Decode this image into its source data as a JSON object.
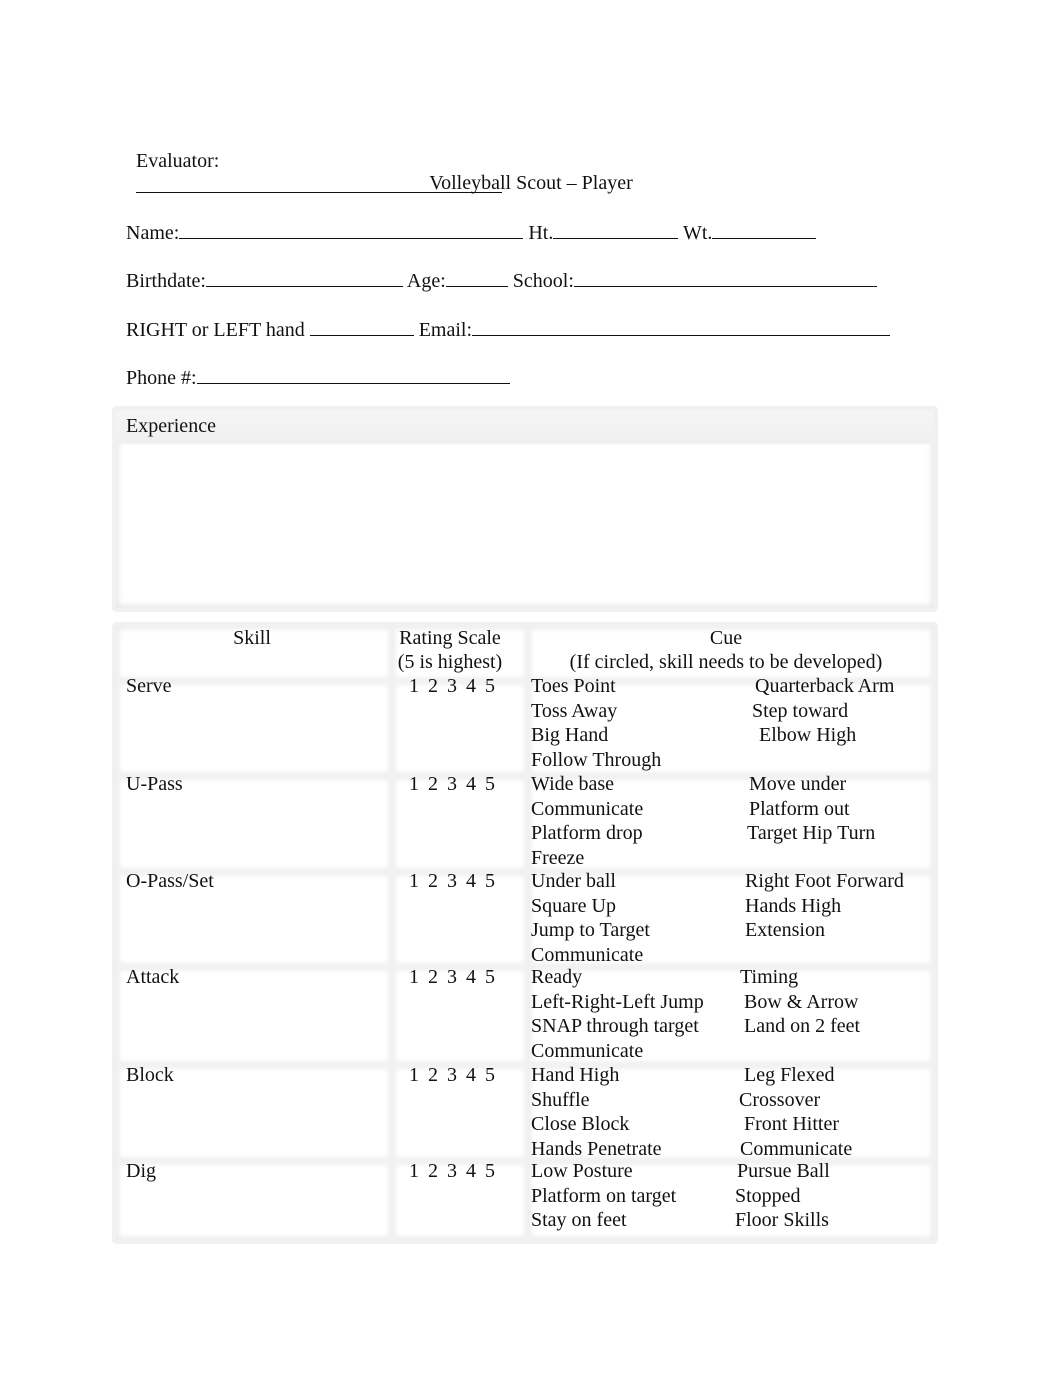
{
  "header": {
    "evaluator_label": "Evaluator:",
    "title": "Volleyball Scout – Player",
    "name_label": "Name:",
    "ht_label": "Ht.",
    "wt_label": "Wt.",
    "birthdate_label": "Birthdate:",
    "age_label": "Age:",
    "school_label": "School:",
    "hand_label": "RIGHT or LEFT hand",
    "email_label": "Email:",
    "phone_label": "Phone #:"
  },
  "experience": {
    "label": "Experience",
    "value": ""
  },
  "table": {
    "headers": {
      "skill": "Skill",
      "rating_line1": "Rating Scale",
      "rating_line2": "(5 is highest)",
      "cue_line1": "Cue",
      "cue_line2": "(If circled, skill needs to be developed)"
    },
    "rows": [
      {
        "skill": "Serve",
        "rating": "1 2 3 4 5",
        "cues_left": [
          "Toes Point",
          "Toss Away",
          "Big Hand",
          "Follow Through"
        ],
        "cues_right": [
          "Quarterback Arm",
          "Step toward",
          "Elbow High"
        ]
      },
      {
        "skill": "U-Pass",
        "rating": "1 2 3 4 5",
        "cues_left": [
          "Wide base",
          "Communicate",
          "Platform drop",
          "Freeze"
        ],
        "cues_right": [
          "Move under",
          "Platform out",
          "Target Hip Turn"
        ]
      },
      {
        "skill": "O-Pass/Set",
        "rating": "1 2 3 4 5",
        "cues_left": [
          "Under ball",
          "Square Up",
          "Jump to Target",
          "Communicate"
        ],
        "cues_right": [
          "Right Foot Forward",
          "Hands High",
          "Extension"
        ]
      },
      {
        "skill": "Attack",
        "rating": "1 2 3 4 5",
        "cues_left": [
          "Ready",
          "Left-Right-Left Jump",
          "SNAP through target",
          "Communicate"
        ],
        "cues_right": [
          "Timing",
          "Bow & Arrow",
          "Land on 2 feet"
        ]
      },
      {
        "skill": "Block",
        "rating": "1 2 3 4 5",
        "cues_left": [
          "Hand High",
          "Shuffle",
          "Close Block",
          "Hands Penetrate"
        ],
        "cues_right": [
          "Leg Flexed",
          "Crossover",
          "Front Hitter",
          "Communicate"
        ]
      },
      {
        "skill": "Dig",
        "rating": "1 2 3 4 5",
        "cues_left": [
          "Low Posture",
          "Platform on target",
          "Stay on feet"
        ],
        "cues_right": [
          "Pursue Ball",
          "Stopped",
          "Floor Skills"
        ]
      }
    ]
  }
}
